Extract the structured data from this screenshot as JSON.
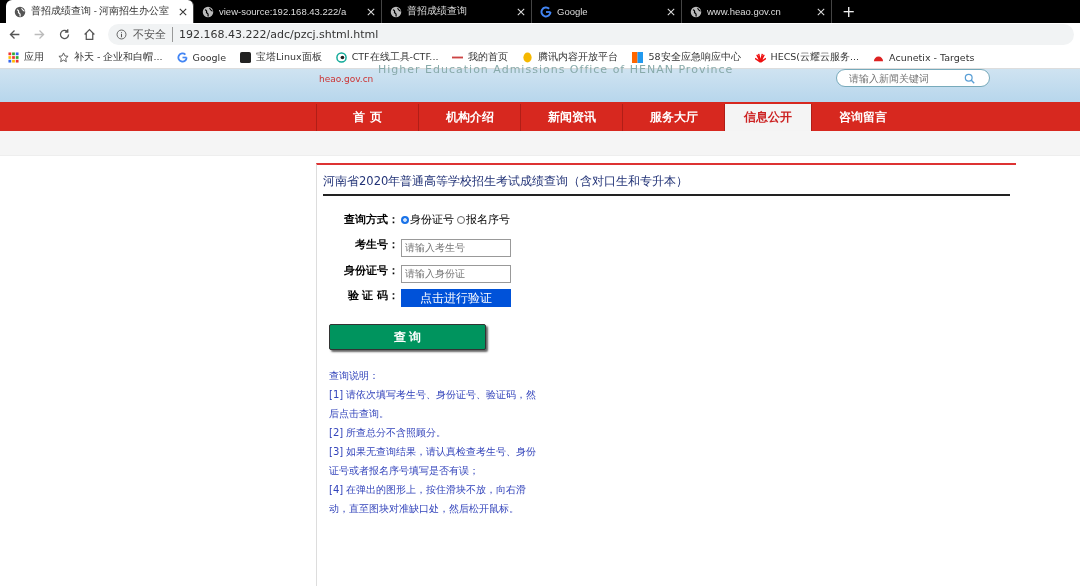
{
  "browser": {
    "tabs": [
      {
        "title": "普招成绩查询 - 河南招生办公室",
        "selected": true
      },
      {
        "title": "view-source:192.168.43.222/a",
        "selected": false
      },
      {
        "title": "普招成绩查询",
        "selected": false
      },
      {
        "title": "Google",
        "selected": false
      },
      {
        "title": "www.heao.gov.cn",
        "selected": false
      }
    ],
    "new_tab": "+",
    "security": "不安全",
    "url": "192.168.43.222/adc/pzcj.shtml.html",
    "bookmarks": [
      {
        "label": "应用"
      },
      {
        "label": "补天 - 企业和白帽..."
      },
      {
        "label": "Google"
      },
      {
        "label": "宝塔Linux面板"
      },
      {
        "label": "CTF在线工具-CTF..."
      },
      {
        "label": "我的首页"
      },
      {
        "label": "腾讯内容开放平台"
      },
      {
        "label": "58安全应急响应中心"
      },
      {
        "label": "HECS(云耀云服务..."
      },
      {
        "label": "Acunetix - Targets"
      }
    ]
  },
  "header": {
    "site": "heao.gov.cn",
    "subtitle": "Higher Education Admissions Office of HENAN Province",
    "search_placeholder": "请输入新闻关键词"
  },
  "nav": [
    {
      "label": "首 页",
      "selected": false
    },
    {
      "label": "机构介绍",
      "selected": false
    },
    {
      "label": "新闻资讯",
      "selected": false
    },
    {
      "label": "服务大厅",
      "selected": false
    },
    {
      "label": "信息公开",
      "selected": true
    },
    {
      "label": "咨询留言",
      "selected": false
    }
  ],
  "form": {
    "title": "河南省2020年普通高等学校招生考试成绩查询（含对口生和专升本）",
    "mode_label": "查询方式：",
    "modes": [
      {
        "label": "身份证号",
        "selected": true
      },
      {
        "label": "报名序号",
        "selected": false
      }
    ],
    "fields": [
      {
        "label": "考生号：",
        "placeholder": "请输入考生号"
      },
      {
        "label": "身份证号：",
        "placeholder": "请输入身份证"
      }
    ],
    "captcha_label": "验 证 码：",
    "captcha_button": "点击进行验证",
    "submit": "查 询",
    "notes_title": "查询说明：",
    "notes": [
      "[1] 请依次填写考生号、身份证号、验证码，然后点击查询。",
      "[2] 所查总分不含照顾分。",
      "[3] 如果无查询结果，请认真检查考生号、身份证号或者报名序号填写是否有误；",
      "[4] 在弹出的图形上，按住滑块不放，向右滑动，直至图块对准缺口处，然后松开鼠标。"
    ]
  }
}
